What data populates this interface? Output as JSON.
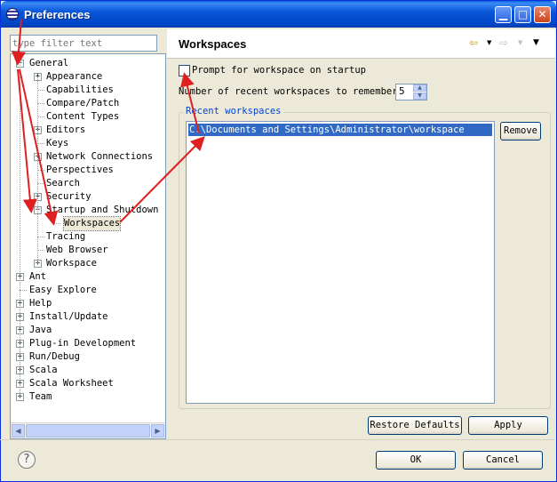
{
  "window": {
    "title": "Preferences"
  },
  "filter": {
    "placeholder": "type filter text"
  },
  "tree": [
    {
      "label": "General",
      "level": 0,
      "expander": "minus"
    },
    {
      "label": "Appearance",
      "level": 1,
      "expander": "plus"
    },
    {
      "label": "Capabilities",
      "level": 1,
      "expander": ""
    },
    {
      "label": "Compare/Patch",
      "level": 1,
      "expander": ""
    },
    {
      "label": "Content Types",
      "level": 1,
      "expander": ""
    },
    {
      "label": "Editors",
      "level": 1,
      "expander": "plus"
    },
    {
      "label": "Keys",
      "level": 1,
      "expander": ""
    },
    {
      "label": "Network Connections",
      "level": 1,
      "expander": "plus"
    },
    {
      "label": "Perspectives",
      "level": 1,
      "expander": ""
    },
    {
      "label": "Search",
      "level": 1,
      "expander": ""
    },
    {
      "label": "Security",
      "level": 1,
      "expander": "plus"
    },
    {
      "label": "Startup and Shutdown",
      "level": 1,
      "expander": "minus"
    },
    {
      "label": "Workspaces",
      "level": 2,
      "expander": "",
      "selected": true
    },
    {
      "label": "Tracing",
      "level": 1,
      "expander": ""
    },
    {
      "label": "Web Browser",
      "level": 1,
      "expander": ""
    },
    {
      "label": "Workspace",
      "level": 1,
      "expander": "plus"
    },
    {
      "label": "Ant",
      "level": 0,
      "expander": "plus"
    },
    {
      "label": "Easy Explore",
      "level": 0,
      "expander": ""
    },
    {
      "label": "Help",
      "level": 0,
      "expander": "plus"
    },
    {
      "label": "Install/Update",
      "level": 0,
      "expander": "plus"
    },
    {
      "label": "Java",
      "level": 0,
      "expander": "plus"
    },
    {
      "label": "Plug-in Development",
      "level": 0,
      "expander": "plus"
    },
    {
      "label": "Run/Debug",
      "level": 0,
      "expander": "plus"
    },
    {
      "label": "Scala",
      "level": 0,
      "expander": "plus"
    },
    {
      "label": "Scala Worksheet",
      "level": 0,
      "expander": "plus"
    },
    {
      "label": "Team",
      "level": 0,
      "expander": "plus"
    }
  ],
  "page": {
    "title": "Workspaces",
    "prompt_label": "Prompt for workspace on startup",
    "prompt_checked": false,
    "recent_label": "Number of recent workspaces to remember:",
    "recent_value": "5",
    "group_title": "Recent workspaces",
    "workspaces": [
      "C:\\Documents and Settings\\Administrator\\workspace"
    ],
    "remove_label": "Remove",
    "restore_label": "Restore Defaults",
    "apply_label": "Apply"
  },
  "footer": {
    "ok_label": "OK",
    "cancel_label": "Cancel",
    "help_glyph": "?"
  },
  "annotation_color": "#e02020"
}
